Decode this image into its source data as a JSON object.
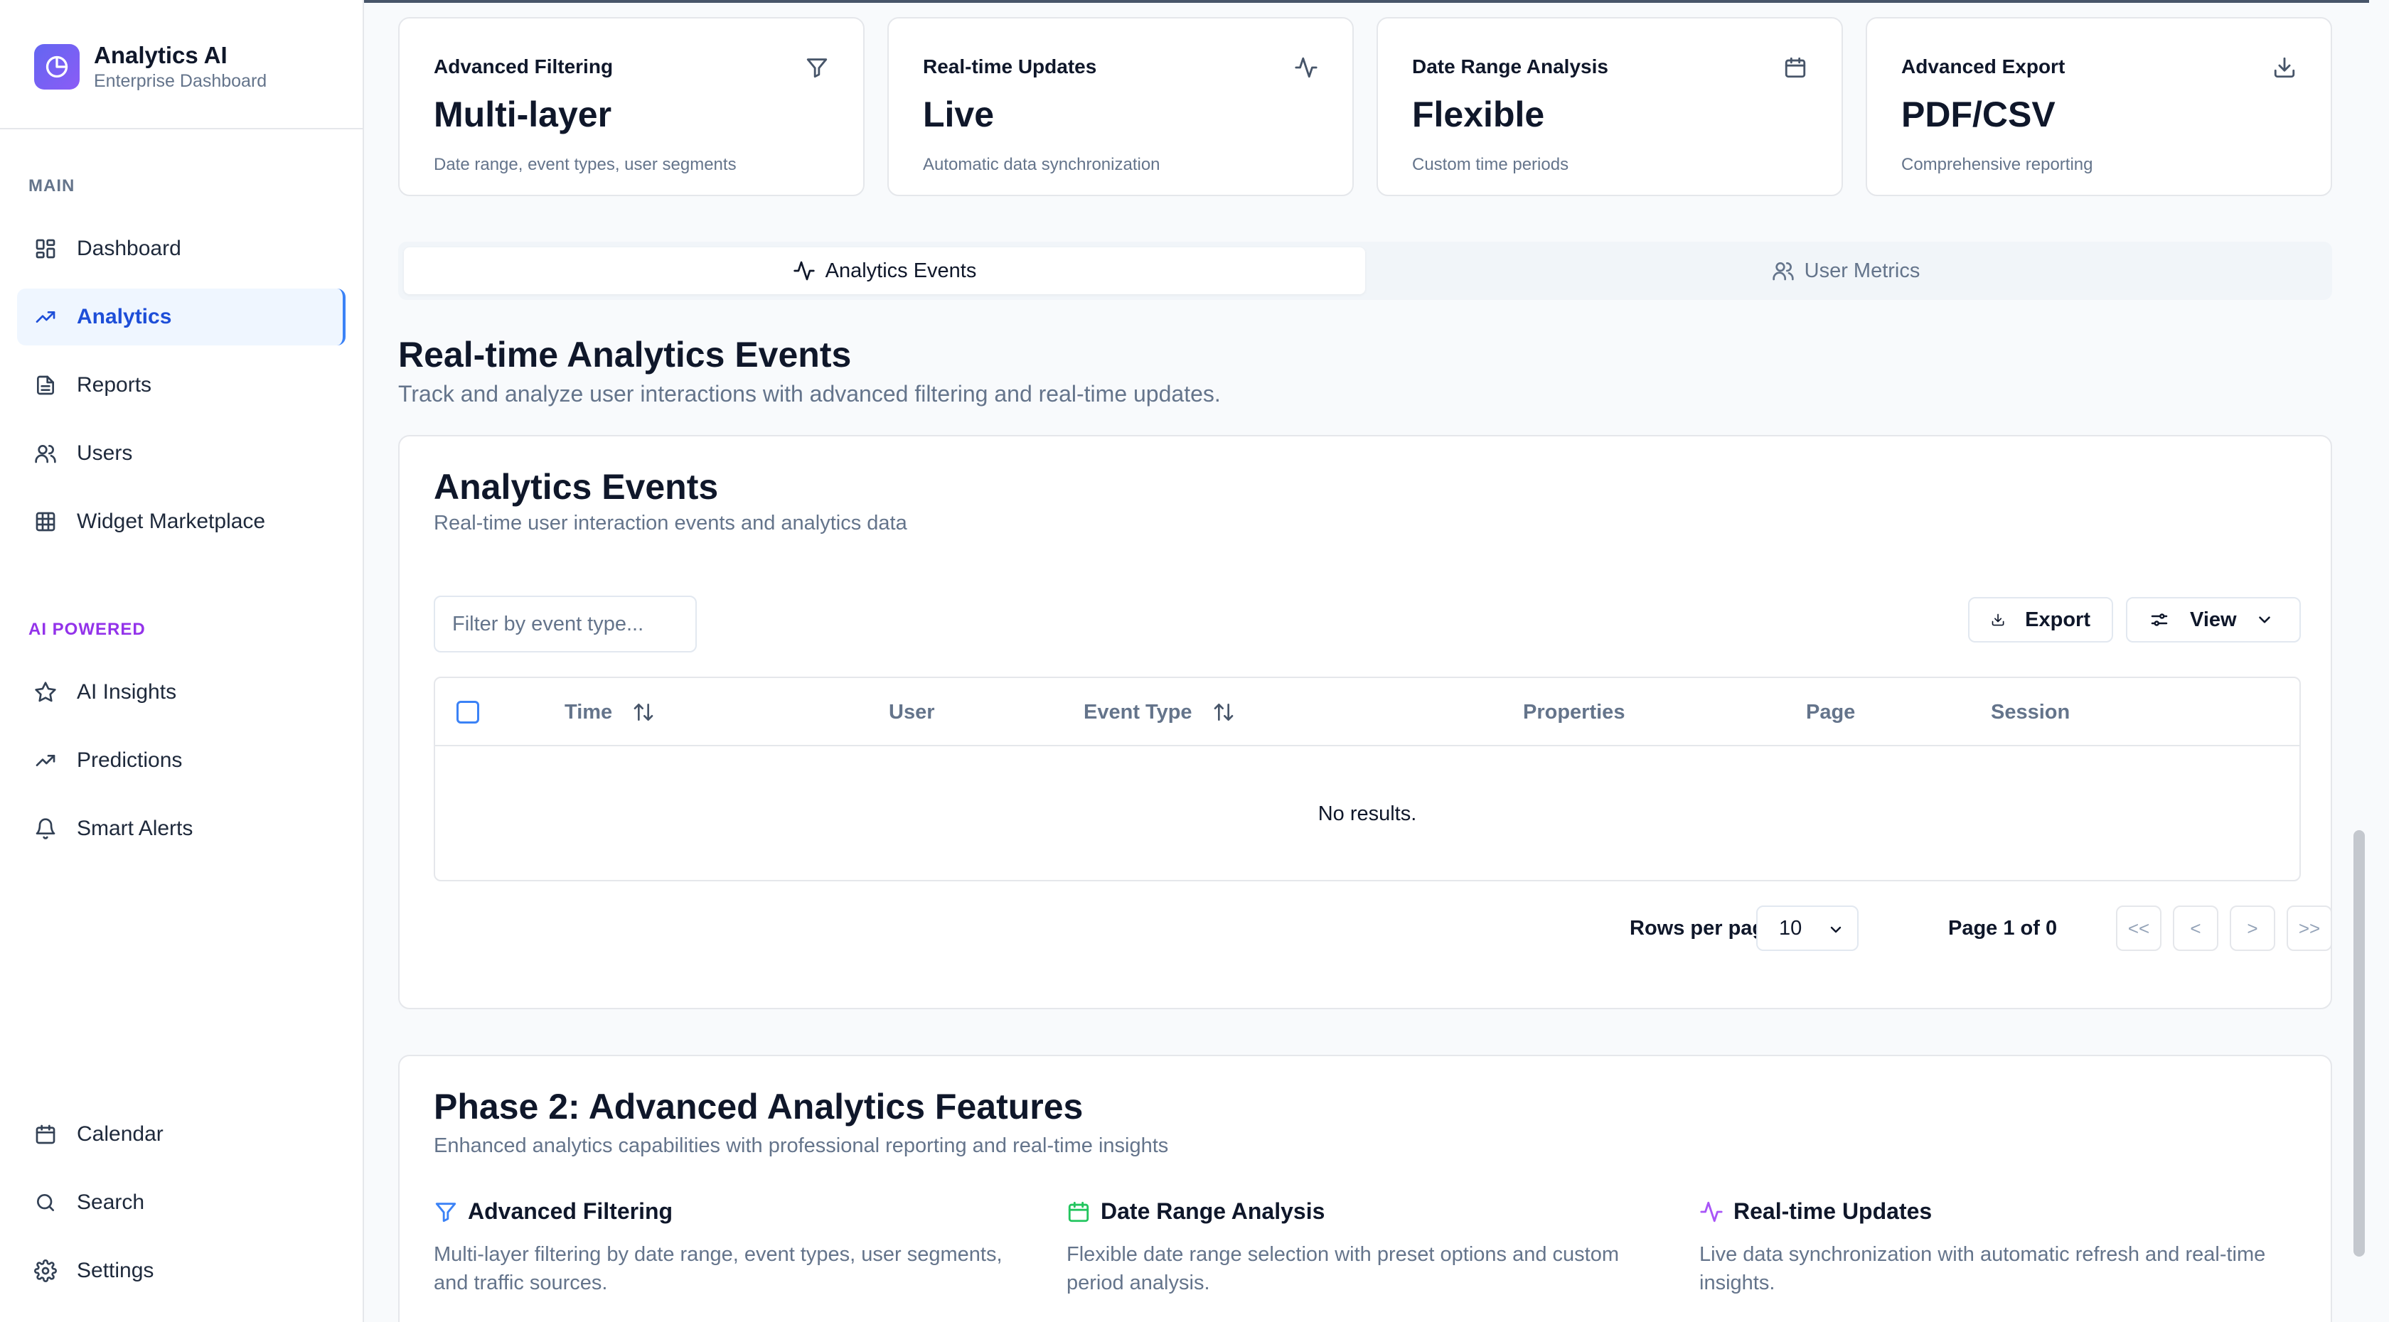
{
  "brand": {
    "title": "Analytics AI",
    "subtitle": "Enterprise Dashboard",
    "icon": "clock-logo-icon",
    "gradient": [
      "#6366f1",
      "#8b5cf6"
    ]
  },
  "sidebar": {
    "main_label": "MAIN",
    "main_items": [
      {
        "label": "Dashboard",
        "icon": "dashboard-icon",
        "active": false
      },
      {
        "label": "Analytics",
        "icon": "trending-up-icon",
        "active": true
      },
      {
        "label": "Reports",
        "icon": "file-text-icon",
        "active": false
      },
      {
        "label": "Users",
        "icon": "users-icon",
        "active": false
      },
      {
        "label": "Widget Marketplace",
        "icon": "grid-icon",
        "active": false
      }
    ],
    "ai_label": "AI POWERED",
    "ai_items": [
      {
        "label": "AI Insights",
        "icon": "star-icon"
      },
      {
        "label": "Predictions",
        "icon": "trending-up-icon"
      },
      {
        "label": "Smart Alerts",
        "icon": "bell-icon"
      }
    ],
    "bottom_items": [
      {
        "label": "Calendar",
        "icon": "calendar-icon"
      },
      {
        "label": "Search",
        "icon": "search-icon"
      },
      {
        "label": "Settings",
        "icon": "gear-icon"
      }
    ]
  },
  "stats": [
    {
      "label": "Advanced Filtering",
      "value": "Multi-layer",
      "desc": "Date range, event types, user segments",
      "icon": "filter-icon"
    },
    {
      "label": "Real-time Updates",
      "value": "Live",
      "desc": "Automatic data synchronization",
      "icon": "activity-icon"
    },
    {
      "label": "Date Range Analysis",
      "value": "Flexible",
      "desc": "Custom time periods",
      "icon": "calendar-icon"
    },
    {
      "label": "Advanced Export",
      "value": "PDF/CSV",
      "desc": "Comprehensive reporting",
      "icon": "download-icon"
    }
  ],
  "tabs": [
    {
      "label": "Analytics Events",
      "icon": "activity-icon",
      "active": true
    },
    {
      "label": "User Metrics",
      "icon": "users-icon",
      "active": false
    }
  ],
  "page": {
    "title": "Real-time Analytics Events",
    "subtitle": "Track and analyze user interactions with advanced filtering and real-time updates."
  },
  "events_panel": {
    "title": "Analytics Events",
    "subtitle": "Real-time user interaction events and analytics data",
    "filter_placeholder": "Filter by event type...",
    "filter_value": "",
    "export_label": "Export",
    "view_label": "View",
    "columns": [
      "Time",
      "User",
      "Event Type",
      "Properties",
      "Page",
      "Session"
    ],
    "sortable_columns": [
      "Time",
      "Event Type"
    ],
    "empty_text": "No results.",
    "rows_per_page_label": "Rows per page",
    "rows_per_page_value": "10",
    "page_info": "Page 1 of 0",
    "pager_buttons": [
      "<<",
      "<",
      ">",
      ">>"
    ]
  },
  "phase": {
    "title": "Phase 2: Advanced Analytics Features",
    "subtitle": "Enhanced analytics capabilities with professional reporting and real-time insights",
    "features": [
      {
        "title": "Advanced Filtering",
        "desc": "Multi-layer filtering by date range, event types, user segments, and traffic sources.",
        "icon": "filter-icon",
        "color": "#3b82f6"
      },
      {
        "title": "Date Range Analysis",
        "desc": "Flexible date range selection with preset options and custom period analysis.",
        "icon": "calendar-icon",
        "color": "#22c55e"
      },
      {
        "title": "Real-time Updates",
        "desc": "Live data synchronization with automatic refresh and real-time insights.",
        "icon": "activity-icon",
        "color": "#a855f7"
      }
    ]
  },
  "colors": {
    "accent": "#3b82f6",
    "ai_label": "#9333ea",
    "active_bg": "#eff6ff"
  }
}
